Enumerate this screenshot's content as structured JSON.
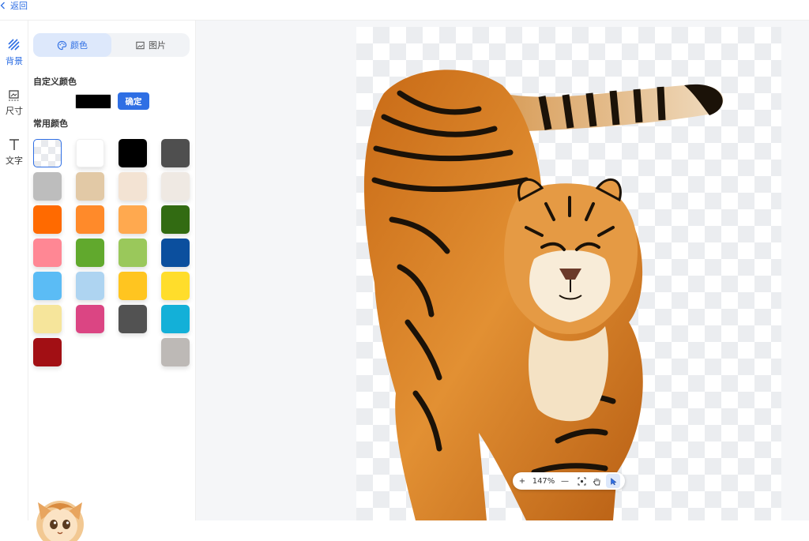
{
  "topbar": {
    "back_label": "返回"
  },
  "rail": [
    {
      "label": "背景",
      "icon": "background-pattern-icon",
      "active": true
    },
    {
      "label": "尺寸",
      "icon": "resize-icon",
      "active": false
    },
    {
      "label": "文字",
      "icon": "text-t-icon",
      "active": false
    }
  ],
  "panel": {
    "tabs": [
      {
        "label": "颜色",
        "icon": "palette-icon",
        "active": true
      },
      {
        "label": "图片",
        "icon": "image-icon",
        "active": false
      }
    ],
    "custom_color_title": "自定义颜色",
    "custom_color_value": "#000000",
    "confirm_label": "确定",
    "common_colors_title": "常用颜色",
    "swatches": [
      "transparent",
      "#ffffff",
      "#000000",
      "#4f4f4f",
      "#bdbdbd",
      "#e2c9a6",
      "#f3e3d3",
      "#efe9e3",
      "#ff6a00",
      "#ff8a2a",
      "#ffa94f",
      "#326b12",
      "#ff8794",
      "#61a92d",
      "#9ac85b",
      "#0b4f9e",
      "#5bbcf5",
      "#aed4f1",
      "#ffc520",
      "#ffdd2b",
      "#f6e59b",
      "#db4583",
      "#525252",
      "#13b0d8",
      "#a20f14",
      null,
      null,
      "#bdb9b6"
    ]
  },
  "zoom": {
    "zoom_in": "+",
    "level": "147%",
    "zoom_out": "—"
  },
  "colors": {
    "accent": "#2f6fe4"
  }
}
